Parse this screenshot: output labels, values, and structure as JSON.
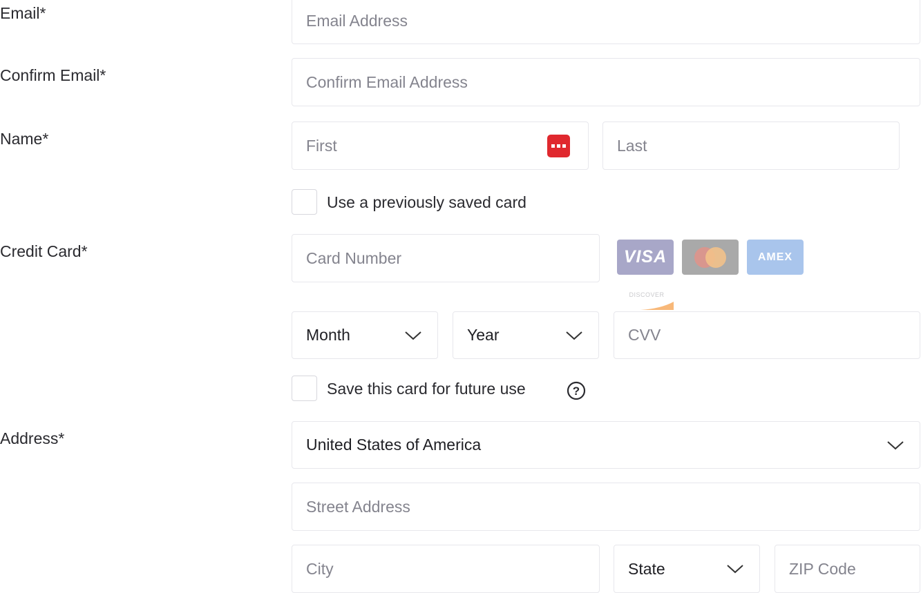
{
  "labels": {
    "email": "Email",
    "confirm_email": "Confirm Email",
    "name": "Name",
    "credit_card": "Credit Card",
    "address": "Address",
    "required_mark": "*"
  },
  "fields": {
    "email_placeholder": "Email Address",
    "confirm_email_placeholder": "Confirm Email Address",
    "first_placeholder": "First",
    "last_placeholder": "Last",
    "card_number_placeholder": "Card Number",
    "cvv_placeholder": "CVV",
    "street_placeholder": "Street Address",
    "city_placeholder": "City",
    "zip_placeholder": "ZIP Code"
  },
  "selects": {
    "month": "Month",
    "year": "Year",
    "country": "United States of America",
    "state": "State"
  },
  "checkboxes": {
    "saved_card": {
      "label": "Use a previously saved card",
      "checked": false
    },
    "save_card": {
      "label": "Save this card for future use",
      "checked": false
    }
  },
  "card_logos": {
    "visa": "VISA",
    "amex": "AMEX",
    "discover": "DISCOVER"
  },
  "icons": {
    "password_manager": "password-manager-icon",
    "help": "help-icon",
    "chevron": "chevron-down-icon"
  },
  "colors": {
    "password_manager_red": "#e0282e",
    "visa_bg": "#a8a7c8",
    "mastercard_bg": "#a9a9a9",
    "amex_bg": "#a9c5ec",
    "discover_accent": "#f5a04c"
  }
}
